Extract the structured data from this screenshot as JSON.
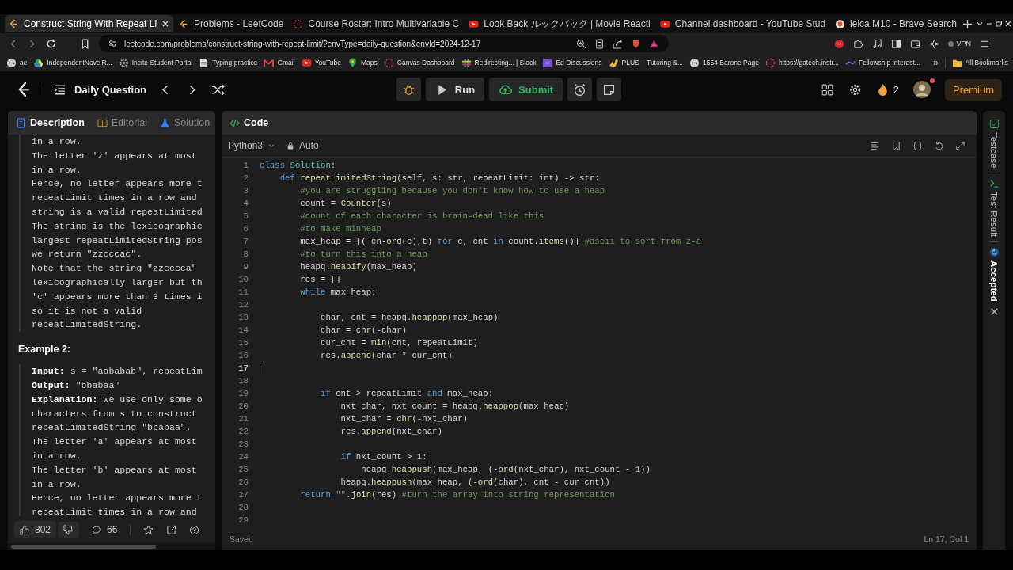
{
  "browser": {
    "tabs": [
      {
        "title": "Construct String With Repeat Li",
        "kind": "leetcode",
        "selected": true
      },
      {
        "title": "Problems - LeetCode",
        "kind": "leetcode",
        "selected": false
      },
      {
        "title": "Course Roster: Intro Multivariable C",
        "kind": "ring",
        "selected": false
      },
      {
        "title": "Look Back ルックバック | Movie Reacti",
        "kind": "youtube",
        "selected": false
      },
      {
        "title": "Channel dashboard - YouTube Stud",
        "kind": "youtube",
        "selected": false
      },
      {
        "title": "leica M10 - Brave Search",
        "kind": "brave",
        "selected": false
      }
    ],
    "address": "leetcode.com/problems/construct-string-with-repeat-limit/?envType=daily-question&envId=2024-12-17",
    "vpn": "VPN",
    "bookmarks": [
      {
        "label": "ae",
        "kind": "globe"
      },
      {
        "label": "IndependentNovelR...",
        "kind": "drive"
      },
      {
        "label": "Incite Student Portal",
        "kind": "gear"
      },
      {
        "label": "Typing practice",
        "kind": "doc"
      },
      {
        "label": "Gmail",
        "kind": "mail"
      },
      {
        "label": "YouTube",
        "kind": "youtube"
      },
      {
        "label": "Maps",
        "kind": "pin"
      },
      {
        "label": "Canvas Dashboard",
        "kind": "ring"
      },
      {
        "label": "Redirecting... | Slack",
        "kind": "slack"
      },
      {
        "label": "Ed Discussions",
        "kind": "ed"
      },
      {
        "label": "PLUS – Tutoring &...",
        "kind": "plus"
      },
      {
        "label": "1554 Barone Page",
        "kind": "globe"
      },
      {
        "label": "https://gatech.instr...",
        "kind": "ring"
      },
      {
        "label": "Fellowship Interest...",
        "kind": "wave"
      }
    ],
    "more_bookmarks": "»",
    "all_bookmarks": "All Bookmarks"
  },
  "nav": {
    "title": "Daily Question",
    "run": "Run",
    "submit": "Submit",
    "streak": "2",
    "premium": "Premium"
  },
  "description": {
    "tabs": [
      {
        "label": "Description",
        "selected": true
      },
      {
        "label": "Editorial",
        "selected": false
      },
      {
        "label": "Solution",
        "selected": false
      }
    ],
    "example1_lines": [
      "in a row.",
      "The letter 'z' appears at most",
      "in a row.",
      "Hence, no letter appears more t",
      "repeatLimit times in a row and",
      "string is a valid repeatLimited",
      "The string is the lexicographic",
      "largest repeatLimitedString pos",
      "we return \"zzcccac\".",
      "Note that the string \"zzcccca\"",
      "lexicographically larger but th",
      "'c' appears more than 3 times i",
      "so it is not a valid",
      "repeatLimitedString."
    ],
    "example2_title": "Example 2:",
    "example2_lines": [
      "**Input:** s = \"aababab\", repeatLim",
      "**Output:** \"bbabaa\"",
      "**Explanation:** We use only some o",
      "characters from s to construct",
      "repeatLimitedString \"bbabaa\".",
      "The letter 'a' appears at most",
      "in a row.",
      "The letter 'b' appears at most",
      "in a row.",
      "Hence, no letter appears more t",
      "repeatLimit times in a row and"
    ],
    "likes": "802",
    "comments": "66"
  },
  "editor": {
    "tab": "Code",
    "language": "Python3",
    "mode": "Auto",
    "lines": [
      {
        "n": "1",
        "segs": [
          {
            "kind": "kw",
            "t": "class "
          },
          {
            "kind": "cls",
            "t": "Solution"
          },
          {
            "kind": "tx",
            "t": ":"
          }
        ]
      },
      {
        "n": "2",
        "segs": [
          {
            "kind": "kw",
            "t": "    def "
          },
          {
            "kind": "fn",
            "t": "repeatLimitedString"
          },
          {
            "kind": "tx",
            "t": "(self, s: str, repeatLimit: int) -> str:"
          }
        ]
      },
      {
        "n": "3",
        "segs": [
          {
            "kind": "cm",
            "t": "        #you are struggling because you don't know how to use a heap"
          }
        ]
      },
      {
        "n": "4",
        "segs": [
          {
            "kind": "tx",
            "t": "        count = "
          },
          {
            "kind": "fn",
            "t": "Counter"
          },
          {
            "kind": "tx",
            "t": "(s)"
          }
        ]
      },
      {
        "n": "5",
        "segs": [
          {
            "kind": "cm",
            "t": "        #count of each character is brain-dead like this"
          }
        ]
      },
      {
        "n": "6",
        "segs": [
          {
            "kind": "cm",
            "t": "        #to make minheap"
          }
        ]
      },
      {
        "n": "7",
        "segs": [
          {
            "kind": "tx",
            "t": "        max_heap = [( cn-"
          },
          {
            "kind": "fn",
            "t": "ord"
          },
          {
            "kind": "tx",
            "t": "(c),t) "
          },
          {
            "kind": "kw",
            "t": "for"
          },
          {
            "kind": "tx",
            "t": " c, cnt "
          },
          {
            "kind": "kw",
            "t": "in"
          },
          {
            "kind": "tx",
            "t": " count."
          },
          {
            "kind": "fn",
            "t": "items"
          },
          {
            "kind": "tx",
            "t": "()] "
          },
          {
            "kind": "cm",
            "t": "#ascii to sort from z-a"
          }
        ]
      },
      {
        "n": "8",
        "segs": [
          {
            "kind": "cm",
            "t": "        #to turn this into a heap"
          }
        ]
      },
      {
        "n": "9",
        "segs": [
          {
            "kind": "tx",
            "t": "        heapq."
          },
          {
            "kind": "fn",
            "t": "heapify"
          },
          {
            "kind": "tx",
            "t": "(max_heap)"
          }
        ]
      },
      {
        "n": "10",
        "segs": [
          {
            "kind": "tx",
            "t": "        res = []"
          }
        ]
      },
      {
        "n": "11",
        "segs": [
          {
            "kind": "kw",
            "t": "        while"
          },
          {
            "kind": "tx",
            "t": " max_heap:"
          }
        ]
      },
      {
        "n": "12"
      },
      {
        "n": "13",
        "segs": [
          {
            "kind": "tx",
            "t": "            char, cnt = heapq."
          },
          {
            "kind": "fn",
            "t": "heappop"
          },
          {
            "kind": "tx",
            "t": "(max_heap)"
          }
        ]
      },
      {
        "n": "14",
        "segs": [
          {
            "kind": "tx",
            "t": "            char = "
          },
          {
            "kind": "fn",
            "t": "chr"
          },
          {
            "kind": "tx",
            "t": "(-char)"
          }
        ]
      },
      {
        "n": "15",
        "segs": [
          {
            "kind": "tx",
            "t": "            cur_cnt = "
          },
          {
            "kind": "fn",
            "t": "min"
          },
          {
            "kind": "tx",
            "t": "(cnt, repeatLimit)"
          }
        ]
      },
      {
        "n": "16",
        "segs": [
          {
            "kind": "tx",
            "t": "            res."
          },
          {
            "kind": "fn",
            "t": "append"
          },
          {
            "kind": "tx",
            "t": "(char * cur_cnt)"
          }
        ]
      },
      {
        "n": "17",
        "cursor": true
      },
      {
        "n": "18"
      },
      {
        "n": "19",
        "segs": [
          {
            "kind": "kw",
            "t": "            if"
          },
          {
            "kind": "tx",
            "t": " cnt > repeatLimit "
          },
          {
            "kind": "kw",
            "t": "and"
          },
          {
            "kind": "tx",
            "t": " max_heap:"
          }
        ]
      },
      {
        "n": "20",
        "segs": [
          {
            "kind": "tx",
            "t": "                nxt_char, nxt_count = heapq."
          },
          {
            "kind": "fn",
            "t": "heappop"
          },
          {
            "kind": "tx",
            "t": "(max_heap)"
          }
        ]
      },
      {
        "n": "21",
        "segs": [
          {
            "kind": "tx",
            "t": "                nxt_char = "
          },
          {
            "kind": "fn",
            "t": "chr"
          },
          {
            "kind": "tx",
            "t": "(-nxt_char)"
          }
        ]
      },
      {
        "n": "22",
        "segs": [
          {
            "kind": "tx",
            "t": "                res."
          },
          {
            "kind": "fn",
            "t": "append"
          },
          {
            "kind": "tx",
            "t": "(nxt_char)"
          }
        ]
      },
      {
        "n": "23"
      },
      {
        "n": "24",
        "segs": [
          {
            "kind": "kw",
            "t": "                if"
          },
          {
            "kind": "tx",
            "t": " nxt_count > "
          },
          {
            "kind": "num",
            "t": "1"
          },
          {
            "kind": "tx",
            "t": ":"
          }
        ]
      },
      {
        "n": "25",
        "segs": [
          {
            "kind": "tx",
            "t": "                    heapq."
          },
          {
            "kind": "fn",
            "t": "heappush"
          },
          {
            "kind": "tx",
            "t": "(max_heap, (-"
          },
          {
            "kind": "fn",
            "t": "ord"
          },
          {
            "kind": "tx",
            "t": "(nxt_char), nxt_count - "
          },
          {
            "kind": "num",
            "t": "1"
          },
          {
            "kind": "tx",
            "t": "))"
          }
        ]
      },
      {
        "n": "26",
        "segs": [
          {
            "kind": "tx",
            "t": "                heapq."
          },
          {
            "kind": "fn",
            "t": "heappush"
          },
          {
            "kind": "tx",
            "t": "(max_heap, (-"
          },
          {
            "kind": "fn",
            "t": "ord"
          },
          {
            "kind": "tx",
            "t": "(char), cnt - cur_cnt))"
          }
        ]
      },
      {
        "n": "27",
        "segs": [
          {
            "kind": "kw",
            "t": "        return"
          },
          {
            "kind": "str",
            "t": " \"\""
          },
          {
            "kind": "tx",
            "t": "."
          },
          {
            "kind": "fn",
            "t": "join"
          },
          {
            "kind": "tx",
            "t": "(res) "
          },
          {
            "kind": "cm",
            "t": "#turn the array into string representation"
          }
        ]
      },
      {
        "n": "28"
      },
      {
        "n": "29"
      }
    ],
    "status": "Saved",
    "position": "Ln 17, Col 1"
  },
  "side_tabs": [
    {
      "label": "Testcase",
      "kind": "testcase",
      "selected": false
    },
    {
      "label": "Test Result",
      "kind": "result",
      "selected": false
    },
    {
      "label": "Accepted",
      "kind": "accepted",
      "selected": true
    }
  ]
}
